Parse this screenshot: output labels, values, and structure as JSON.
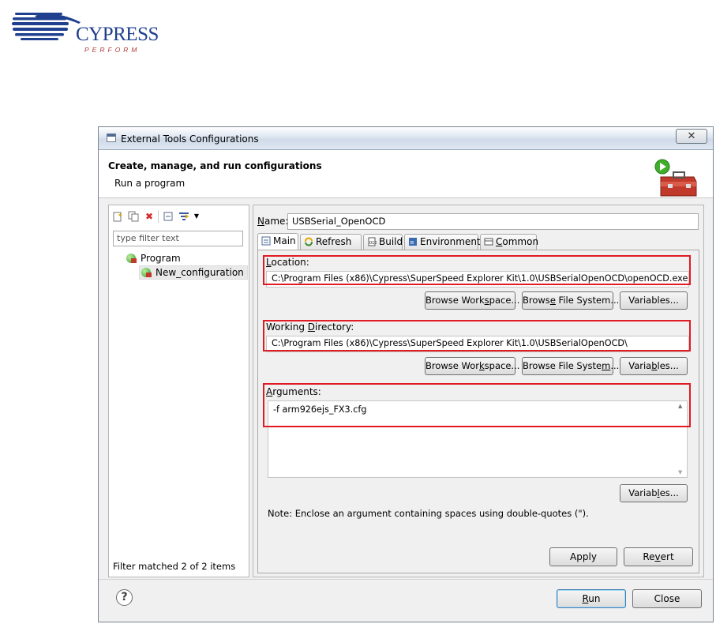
{
  "logo": {
    "word": "CYPRESS",
    "tagline": "PERFORM",
    "colors": {
      "brand_blue": "#1f3f8f",
      "tagline_red": "#b43a3a"
    }
  },
  "window": {
    "title": "External Tools Configurations",
    "close_glyph": "✕"
  },
  "header": {
    "title": "Create, manage, and run configurations",
    "subtitle": "Run a program",
    "icon": "toolbox-run-icon"
  },
  "left_pane": {
    "toolbar_icons": [
      "new-launch-config-icon",
      "duplicate-icon",
      "delete-icon",
      "collapse-all-icon",
      "filter-icon",
      "dropdown-arrow-icon"
    ],
    "filter_placeholder": "type filter text",
    "tree": {
      "category": "Program",
      "items": [
        "New_configuration"
      ]
    },
    "status": "Filter matched 2 of 2 items"
  },
  "right_pane": {
    "name_label": "Name:",
    "name_value": "USBSerial_OpenOCD",
    "tabs": [
      {
        "label": "Main",
        "icon": "main-tab-icon",
        "active": true
      },
      {
        "label": "Refresh",
        "icon": "refresh-icon",
        "active": false
      },
      {
        "label": "Build",
        "icon": "build-icon",
        "active": false
      },
      {
        "label": "Environment",
        "icon": "environment-icon",
        "active": false
      },
      {
        "label": "Common",
        "icon": "common-icon",
        "active": false
      }
    ],
    "location": {
      "label": "Location:",
      "value": "C:\\Program Files (x86)\\Cypress\\SuperSpeed Explorer Kit\\1.0\\USBSerialOpenOCD\\openOCD.exe"
    },
    "working_dir": {
      "label": "Working Directory:",
      "value": "C:\\Program Files (x86)\\Cypress\\SuperSpeed Explorer Kit\\1.0\\USBSerialOpenOCD\\"
    },
    "arguments": {
      "label": "Arguments:",
      "value": "-f arm926ejs_FX3.cfg"
    },
    "buttons": {
      "browse_workspace": "Browse Workspace...",
      "browse_fs": "Browse File System...",
      "variables": "Variables..."
    },
    "note": "Note: Enclose an argument containing spaces using double-quotes (\").",
    "apply": "Apply",
    "revert": "Revert"
  },
  "footer": {
    "help": "?",
    "run": "Run",
    "close": "Close"
  },
  "colors": {
    "highlight_box": "#e01b24",
    "selection_bg": "#e9e9ea"
  }
}
